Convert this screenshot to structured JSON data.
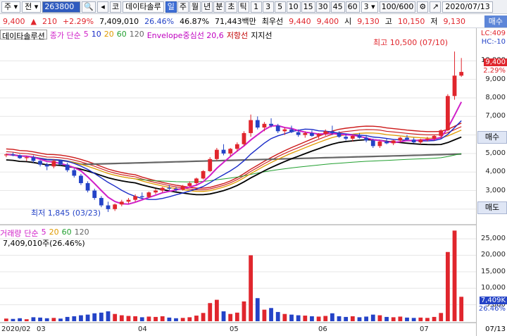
{
  "toolbar": {
    "type_select": "주",
    "market_select": "전",
    "code": "263800",
    "search_icon": "search-icon",
    "speaker_icon": "speaker-icon",
    "market_label": "코",
    "stock_name": "데이타솔루",
    "period_buttons": [
      "일",
      "주",
      "월",
      "년",
      "분",
      "초",
      "틱"
    ],
    "minute_buttons": [
      "1",
      "3",
      "5",
      "10",
      "15",
      "30",
      "45",
      "60"
    ],
    "minute_select": "3",
    "count": "100/600",
    "date": "2020/07/13"
  },
  "quote": {
    "price": "9,400",
    "change": "210",
    "change_pct": "+2.29%",
    "volume": "7,409,010",
    "pct1": "26.46%",
    "pct2": "46.87%",
    "amount": "71,443백만",
    "preferred_label": "최우선",
    "bid": "9,440",
    "ask": "9,400",
    "open_label": "시",
    "open": "9,130",
    "high_label": "고",
    "high": "10,150",
    "low_label": "저",
    "low": "9,130",
    "sell_button": "매수"
  },
  "legend": {
    "stock": "데이타솔루션",
    "ma_label": "종가 단순",
    "ma_periods": [
      "5",
      "10",
      "20",
      "60",
      "120"
    ],
    "envelope": "Envelope중심선 20,6",
    "resistance": "저항선",
    "support": "지지선"
  },
  "annotations": {
    "high": "최고 10,500 (07/10)",
    "low": "최저 1,845 (03/23)"
  },
  "volume_legend": {
    "title": "거래량",
    "ma_label": "단순",
    "ma_periods": [
      "5",
      "20",
      "60",
      "120"
    ],
    "info": "7,409,010주(26.46%)"
  },
  "right_axis": {
    "lc": "LC:409",
    "hc": "HC:-10",
    "price_ticks": [
      "10,000",
      "9,000",
      "8,000",
      "7,000",
      "6,000",
      "5,000",
      "4,000",
      "3,000",
      "2,000"
    ],
    "current_price": "9,400",
    "current_pct": "2.29%",
    "buy_button": "매수",
    "sell_button": "매도",
    "volume_ticks": [
      "25,000",
      "20,000",
      "15,000",
      "10,000",
      "5,000"
    ],
    "volume_current": "7,409K",
    "volume_pct": "26.46%",
    "date_end": "07/13"
  },
  "x_axis": [
    "2020/02",
    "03",
    "04",
    "05",
    "06",
    "07"
  ],
  "colors": {
    "up": "#e0262d",
    "down": "#2443c7",
    "ma5": "#d020c8",
    "ma10": "#1a2cc8",
    "ma20": "#e09a00",
    "ma60": "#22a030",
    "ma120": "#666666",
    "envelope": "#cc1818"
  },
  "chart_data": {
    "type": "candlestick",
    "price_range": [
      1500,
      11000
    ],
    "volume_range": [
      0,
      28000
    ],
    "candles": [
      [
        4900,
        5000,
        4800,
        4950,
        800
      ],
      [
        4950,
        5050,
        4850,
        4900,
        700
      ],
      [
        4900,
        4950,
        4700,
        4750,
        900
      ],
      [
        4750,
        4850,
        4600,
        4800,
        600
      ],
      [
        4800,
        4900,
        4500,
        4600,
        1200
      ],
      [
        4600,
        4650,
        4300,
        4400,
        1100
      ],
      [
        4400,
        4500,
        4100,
        4300,
        900
      ],
      [
        4300,
        4700,
        4200,
        4600,
        1000
      ],
      [
        4600,
        4650,
        4350,
        4400,
        800
      ],
      [
        4400,
        4500,
        4000,
        4100,
        1300
      ],
      [
        4100,
        4200,
        3700,
        3800,
        1500
      ],
      [
        3800,
        3900,
        3300,
        3400,
        1800
      ],
      [
        3400,
        3500,
        2900,
        3000,
        2000
      ],
      [
        3000,
        3100,
        2500,
        2600,
        2400
      ],
      [
        2600,
        2700,
        2100,
        2200,
        2600
      ],
      [
        2200,
        2400,
        1845,
        2000,
        3000
      ],
      [
        2000,
        2300,
        1900,
        2250,
        2200
      ],
      [
        2250,
        2500,
        2150,
        2400,
        1800
      ],
      [
        2400,
        2600,
        2300,
        2500,
        1600
      ],
      [
        2500,
        2800,
        2400,
        2700,
        1500
      ],
      [
        2700,
        2900,
        2600,
        2650,
        1200
      ],
      [
        2650,
        2950,
        2600,
        2900,
        1400
      ],
      [
        2900,
        3100,
        2800,
        3000,
        1300
      ],
      [
        3000,
        3200,
        2900,
        3150,
        1500
      ],
      [
        3150,
        3300,
        3000,
        3100,
        1100
      ],
      [
        3100,
        3200,
        2950,
        3050,
        900
      ],
      [
        3050,
        3300,
        3000,
        3250,
        1000
      ],
      [
        3250,
        3500,
        3200,
        3400,
        1200
      ],
      [
        3400,
        3700,
        3300,
        3650,
        1700
      ],
      [
        3650,
        4100,
        3600,
        4050,
        2500
      ],
      [
        4050,
        4800,
        4000,
        4700,
        5500
      ],
      [
        4700,
        5300,
        4600,
        5200,
        6500
      ],
      [
        5200,
        5500,
        4900,
        5000,
        3000
      ],
      [
        5000,
        5300,
        4850,
        5250,
        2200
      ],
      [
        5250,
        5600,
        5100,
        5500,
        2600
      ],
      [
        5500,
        6200,
        5400,
        6100,
        6000
      ],
      [
        6100,
        7100,
        5900,
        6800,
        20000
      ],
      [
        6800,
        7000,
        6300,
        6400,
        7000
      ],
      [
        6400,
        6700,
        6200,
        6600,
        3500
      ],
      [
        6600,
        6900,
        6400,
        6500,
        4000
      ],
      [
        6500,
        6600,
        6100,
        6200,
        2800
      ],
      [
        6200,
        6400,
        6000,
        6300,
        2200
      ],
      [
        6300,
        6500,
        6100,
        6150,
        2000
      ],
      [
        6150,
        6300,
        5900,
        6000,
        1800
      ],
      [
        6000,
        6200,
        5850,
        6100,
        1700
      ],
      [
        6100,
        6250,
        5900,
        5950,
        1500
      ],
      [
        5950,
        6100,
        5800,
        6050,
        1400
      ],
      [
        6050,
        6300,
        5950,
        6200,
        1600
      ],
      [
        6200,
        6500,
        6000,
        6100,
        2400
      ],
      [
        6100,
        6200,
        5850,
        5900,
        1500
      ],
      [
        5900,
        6050,
        5700,
        5800,
        1300
      ],
      [
        5800,
        6000,
        5650,
        5950,
        1500
      ],
      [
        5950,
        6100,
        5800,
        5850,
        1200
      ],
      [
        5850,
        6000,
        5600,
        5700,
        1400
      ],
      [
        5700,
        5800,
        5300,
        5400,
        2000
      ],
      [
        5400,
        5700,
        5300,
        5650,
        1800
      ],
      [
        5650,
        5800,
        5500,
        5550,
        1300
      ],
      [
        5550,
        5750,
        5450,
        5700,
        1200
      ],
      [
        5700,
        5900,
        5600,
        5850,
        1400
      ],
      [
        5850,
        6000,
        5700,
        5750,
        1100
      ],
      [
        5750,
        5850,
        5550,
        5600,
        1000
      ],
      [
        5600,
        5800,
        5500,
        5750,
        1100
      ],
      [
        5750,
        5900,
        5650,
        5800,
        1000
      ],
      [
        5800,
        6000,
        5700,
        5950,
        1300
      ],
      [
        5950,
        6300,
        5850,
        6250,
        2500
      ],
      [
        6250,
        8200,
        6200,
        8100,
        21000
      ],
      [
        8100,
        10500,
        7900,
        9200,
        27500
      ],
      [
        9200,
        10150,
        9130,
        9400,
        7409
      ]
    ]
  }
}
